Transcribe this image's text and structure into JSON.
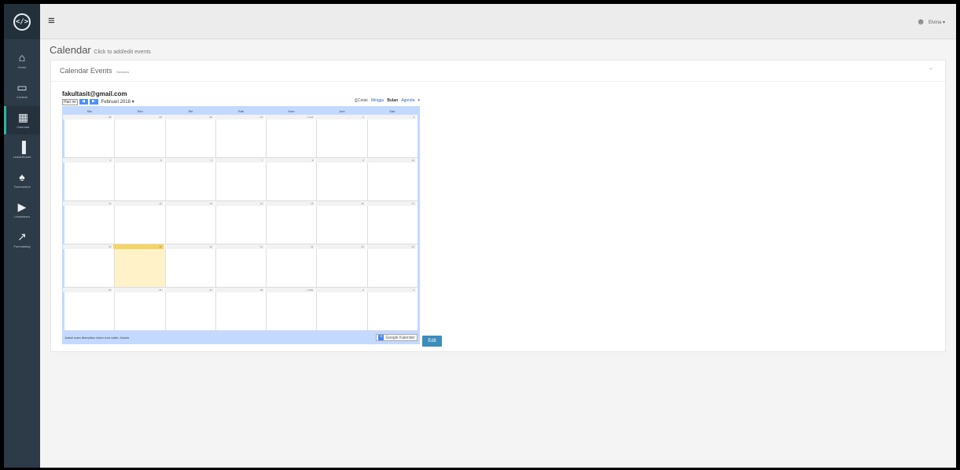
{
  "sidebar": {
    "logo": "</>",
    "items": [
      {
        "label": "Home",
        "icon": "home-icon",
        "glyph": "⌂"
      },
      {
        "label": "Contest",
        "icon": "monitor-icon",
        "glyph": "▭"
      },
      {
        "label": "Calendar",
        "icon": "calendar-icon",
        "glyph": "▦"
      },
      {
        "label": "Leaderboard",
        "icon": "bar-chart-icon",
        "glyph": "▐"
      },
      {
        "label": "Tournament",
        "icon": "trophy-icon",
        "glyph": "♠"
      },
      {
        "label": "Livestream",
        "icon": "video-icon",
        "glyph": "▶"
      },
      {
        "label": "Forecasting",
        "icon": "line-chart-icon",
        "glyph": "↗"
      }
    ]
  },
  "topbar": {
    "menu_glyph": "≡",
    "user_name": "Elvina ▾"
  },
  "page": {
    "title": "Calendar",
    "subtitle": "Click to add/edit events"
  },
  "panel": {
    "title": "Calendar Events",
    "subtitle": "Sessions",
    "collapse_glyph": "−"
  },
  "calendar": {
    "owner": "fakultasit@gmail.com",
    "today_label": "Hari ini",
    "prev_label": "◀",
    "next_label": "▶",
    "month_label": "Februari 2018 ▾",
    "print_label": "Cetak",
    "view_week": "Minggu",
    "view_month": "Bulan",
    "view_agenda": "Agenda",
    "view_dropdown": "▾",
    "weekdays": [
      "Min",
      "Sen",
      "Sel",
      "Rab",
      "Kam",
      "Jum",
      "Sab"
    ],
    "weeks": [
      [
        "28",
        "29",
        "30",
        "31",
        "1 Feb",
        "2",
        "3"
      ],
      [
        "4",
        "5",
        "6",
        "7",
        "8",
        "9",
        "10"
      ],
      [
        "11",
        "12",
        "13",
        "14",
        "15",
        "16",
        "17"
      ],
      [
        "18",
        "19",
        "20",
        "21",
        "22",
        "23",
        "24"
      ],
      [
        "25",
        "26",
        "27",
        "28",
        "1 Mar",
        "2",
        "3"
      ]
    ],
    "timezone_note": "Jadwal acara ditampilkan dalam zona waktu: Jakarta",
    "gcal_label": "Google Kalender",
    "edit_label": "Edit"
  }
}
